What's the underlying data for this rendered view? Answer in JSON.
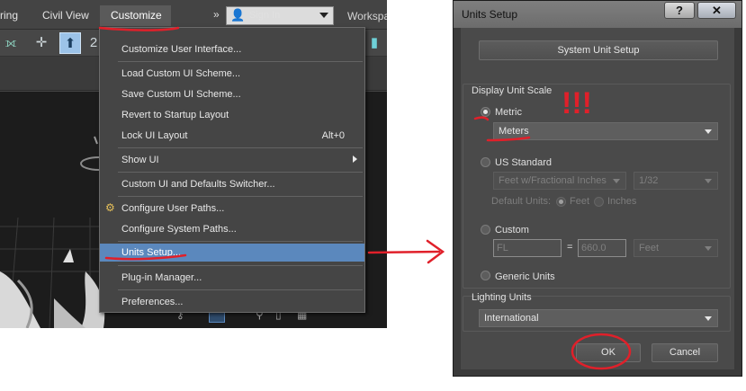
{
  "menubar": {
    "items": [
      {
        "label": "ring"
      },
      {
        "label": "Civil View"
      },
      {
        "label": "Customize"
      }
    ],
    "more_chevron": "»",
    "signin_label": "Sign In",
    "workspace_label": "Workspa"
  },
  "customize_menu": {
    "items": [
      {
        "label": "Customize User Interface..."
      },
      {
        "label": "Load Custom UI Scheme..."
      },
      {
        "label": "Save Custom UI Scheme..."
      },
      {
        "label": "Revert to Startup Layout"
      },
      {
        "label": "Lock UI Layout",
        "shortcut": "Alt+0"
      },
      {
        "label": "Show UI",
        "submenu": true
      },
      {
        "label": "Custom UI and Defaults Switcher..."
      },
      {
        "label": "Configure User Paths..."
      },
      {
        "label": "Configure System Paths..."
      },
      {
        "label": "Units Setup..."
      },
      {
        "label": "Plug-in Manager..."
      },
      {
        "label": "Preferences..."
      }
    ]
  },
  "annotation": {
    "exclamations": "!!!",
    "color": "#e0202a"
  },
  "dialog": {
    "title": "Units Setup",
    "help_button": "?",
    "close_button": "✕",
    "system_unit_setup_label": "System Unit Setup",
    "display_unit_scale": {
      "group_label": "Display Unit Scale",
      "metric_label": "Metric",
      "metric_value": "Meters",
      "us_standard_label": "US Standard",
      "us_units_value": "Feet w/Fractional Inches",
      "us_fraction_value": "1/32",
      "default_units_label": "Default Units:",
      "feet_label": "Feet",
      "inches_label": "Inches",
      "custom_label": "Custom",
      "custom_name_value": "FL",
      "equals_label": "=",
      "custom_amount_value": "660.0",
      "custom_unit_value": "Feet",
      "generic_units_label": "Generic Units",
      "selected": "Metric"
    },
    "lighting_units": {
      "group_label": "Lighting Units",
      "value": "International"
    },
    "ok_label": "OK",
    "cancel_label": "Cancel"
  },
  "colors": {
    "menu_highlight": "#5b88bd",
    "annotation_red": "#e0202a"
  }
}
